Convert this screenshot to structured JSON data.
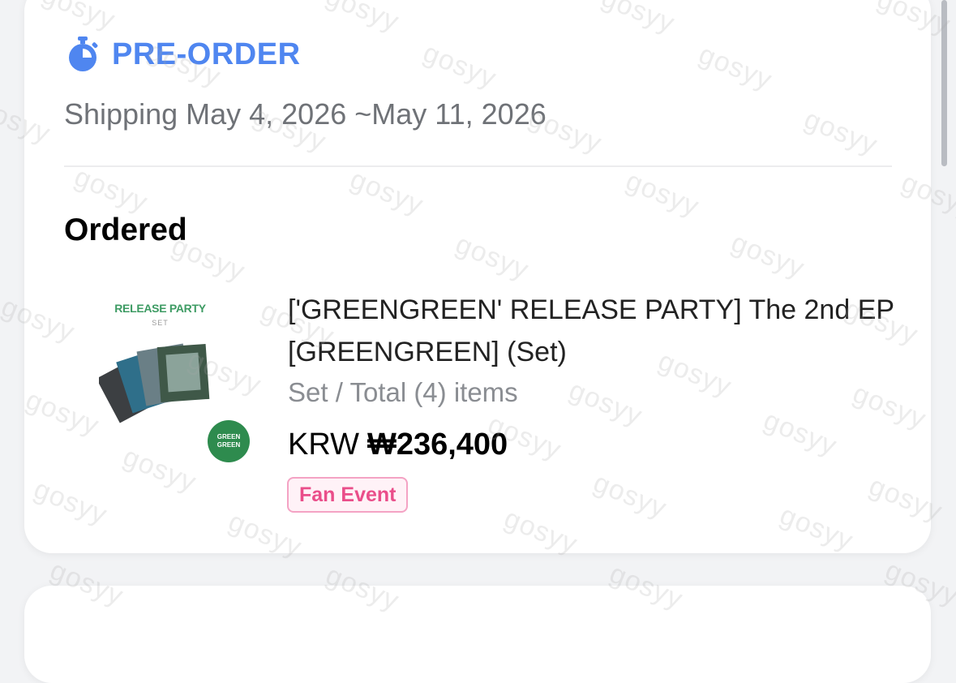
{
  "order": {
    "status_label": "PRE-ORDER",
    "status_icon": "stopwatch-icon",
    "accent_color": "#4f86f0",
    "shipping": "Shipping May 4, 2026 ~May 11, 2026"
  },
  "section": {
    "heading": "Ordered"
  },
  "product": {
    "thumb_title": "RELEASE PARTY",
    "thumb_subtitle": "SET",
    "thumb_badge_line1": "GREEN",
    "thumb_badge_line2": "GREEN",
    "title": "['GREENGREEN' RELEASE PARTY] The 2nd EP [GREENGREEN] (Set)",
    "meta": "Set / Total (4) items",
    "currency": "KRW",
    "price": "₩236,400",
    "tag": "Fan Event",
    "tag_color": "#ea4e8a"
  },
  "watermark": {
    "text": "gosyy"
  }
}
